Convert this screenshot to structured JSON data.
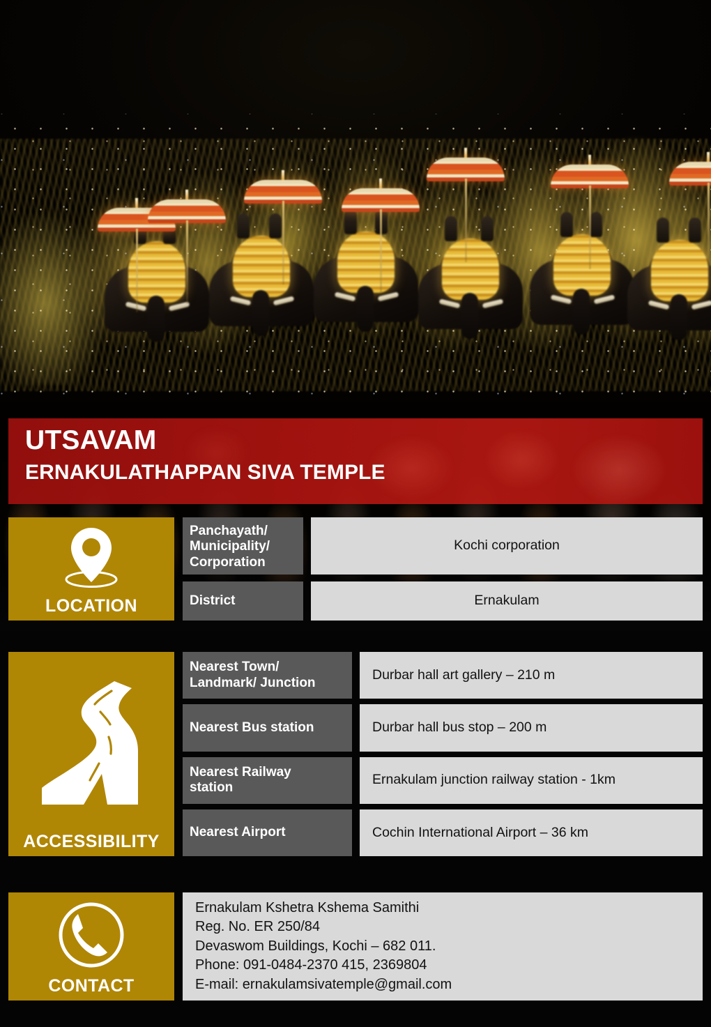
{
  "banner": {
    "title": "UTSAVAM",
    "subtitle": "ERNAKULATHAPPAN SIVA TEMPLE",
    "color": "#B8150F"
  },
  "theme": {
    "gold": "#B08605",
    "label_grey": "#595959",
    "value_grey": "#D9D9D9",
    "page_black": "#050505"
  },
  "hero_photo": {
    "alt": "Night temple festival procession with caparisoned elephants, ceremonial umbrellas and crowd"
  },
  "sections": [
    {
      "id": "location",
      "caption": "LOCATION",
      "icon": "map-pin-icon",
      "rows": [
        {
          "label": "Panchayath/ Municipality/ Corporation",
          "value": "Kochi corporation",
          "align": "center"
        },
        {
          "label": "District",
          "value": "Ernakulam",
          "align": "center"
        }
      ]
    },
    {
      "id": "accessibility",
      "caption": "ACCESSIBILITY",
      "icon": "winding-road-icon",
      "rows": [
        {
          "label": "Nearest Town/ Landmark/ Junction",
          "value": "Durbar hall art gallery – 210 m",
          "align": "left"
        },
        {
          "label": "Nearest Bus station",
          "value": "Durbar hall bus stop – 200 m",
          "align": "left"
        },
        {
          "label": "Nearest Railway station",
          "value": "Ernakulam junction railway station  - 1km",
          "align": "left"
        },
        {
          "label": "Nearest Airport",
          "value": "Cochin International Airport – 36 km",
          "align": "left"
        }
      ]
    },
    {
      "id": "contact",
      "caption": "CONTACT",
      "icon": "phone-circle-icon",
      "lines": [
        "Ernakulam Kshetra Kshema Samithi",
        "Reg. No. ER 250/84",
        "Devaswom Buildings, Kochi – 682 011.",
        "Phone: 091-0484-2370 415, 2369804",
        "E-mail: ernakulamsivatemple@gmail.com"
      ]
    }
  ],
  "location_labels": {
    "panchayath_line1": "Panchayath/",
    "panchayath_line2": "Municipality/",
    "panchayath_line3": "Corporation",
    "district": "District"
  },
  "accessibility_labels": {
    "town_line1": "Nearest Town/",
    "town_line2": "Landmark/ Junction",
    "bus": "Nearest Bus station",
    "rail_line1": "Nearest Railway",
    "rail_line2": "station",
    "airport": "Nearest Airport"
  }
}
